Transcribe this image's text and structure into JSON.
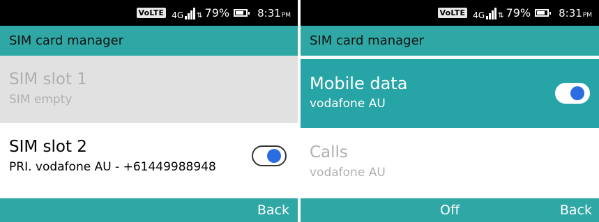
{
  "screens": [
    {
      "status": {
        "volte": "VoLTE",
        "network": "4G",
        "battery": "79%",
        "battery_level": 0.79,
        "time": "8:31",
        "ampm": "PM"
      },
      "title": "SIM card manager",
      "rows": [
        {
          "primary": "SIM slot 1",
          "secondary": "SIM empty",
          "state": "disabled"
        },
        {
          "primary": "SIM slot 2",
          "secondary": "PRI.  vodafone AU - +61449988948",
          "toggle": "on"
        }
      ],
      "softkeys": {
        "right": "Back"
      }
    },
    {
      "status": {
        "volte": "VoLTE",
        "network": "4G",
        "battery": "79%",
        "battery_level": 0.79,
        "time": "8:31",
        "ampm": "PM"
      },
      "title": "SIM card manager",
      "rows": [
        {
          "primary": "Mobile data",
          "secondary": "vodafone AU",
          "toggle": "on",
          "state": "selected"
        },
        {
          "primary": "Calls",
          "secondary": "vodafone AU",
          "state": "disabled"
        }
      ],
      "softkeys": {
        "center": "Off",
        "right": "Back"
      }
    }
  ],
  "colors": {
    "accent": "#2fa8a5",
    "selected_row": "#27a4a6",
    "toggle_knob": "#2b6de0",
    "disabled_row": "#e1e1e1"
  },
  "icons": [
    "signal-bars-icon",
    "data-arrows-icon",
    "battery-icon",
    "volte-badge"
  ]
}
